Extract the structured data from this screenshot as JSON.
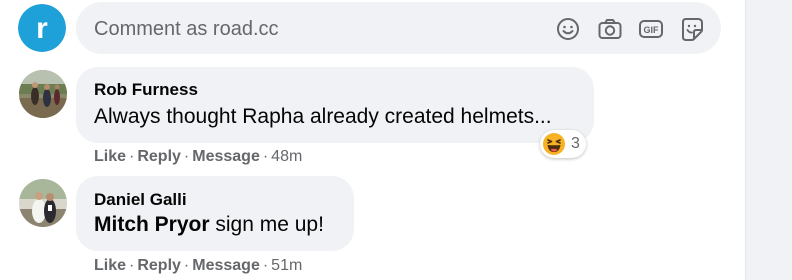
{
  "composer": {
    "placeholder": "Comment as road.cc",
    "avatar_letter": "r",
    "icons": [
      "emoji-icon",
      "camera-icon",
      "gif-icon",
      "sticker-icon"
    ],
    "brand_color": "#1ea0d8"
  },
  "comments": [
    {
      "author": "Rob Furness",
      "text": "Always thought Rapha already created helmets...",
      "reaction": {
        "icon": "haha-emoji-icon",
        "count": "3"
      },
      "actions": {
        "like": "Like",
        "reply": "Reply",
        "message": "Message",
        "time": "48m"
      }
    },
    {
      "author": "Daniel Galli",
      "mention": "Mitch Pryor",
      "text": " sign me up!",
      "actions": {
        "like": "Like",
        "reply": "Reply",
        "message": "Message",
        "time": "51m"
      }
    }
  ],
  "separator": "·"
}
